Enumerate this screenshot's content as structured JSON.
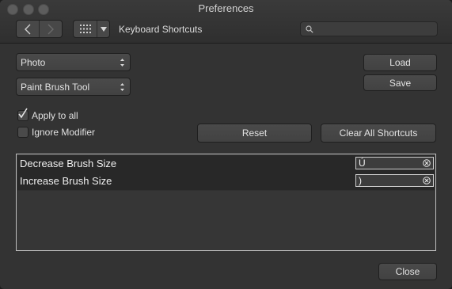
{
  "window": {
    "title": "Preferences"
  },
  "toolbar": {
    "back_icon": "chevron-left-icon",
    "forward_icon": "chevron-right-icon",
    "grid_icon": "grid-icon",
    "dropdown_icon": "triangle-down-icon",
    "section_title": "Keyboard Shortcuts",
    "search": {
      "value": "",
      "placeholder": "",
      "icon": "search-icon"
    }
  },
  "controls": {
    "context_select": "Photo",
    "tool_select": "Paint Brush Tool",
    "load_label": "Load",
    "save_label": "Save",
    "apply_to_all": {
      "label": "Apply to all",
      "checked": true
    },
    "ignore_modifier": {
      "label": "Ignore Modifier",
      "checked": false
    },
    "reset_label": "Reset",
    "clear_all_label": "Clear All Shortcuts"
  },
  "shortcuts": [
    {
      "name": "Decrease Brush Size",
      "key": "Ú"
    },
    {
      "name": "Increase Brush Size",
      "key": ")"
    }
  ],
  "footer": {
    "close_label": "Close"
  },
  "colors": {
    "window_bg": "#333333",
    "panel_border": "#bdbdbd",
    "row_bg": "#282828"
  }
}
